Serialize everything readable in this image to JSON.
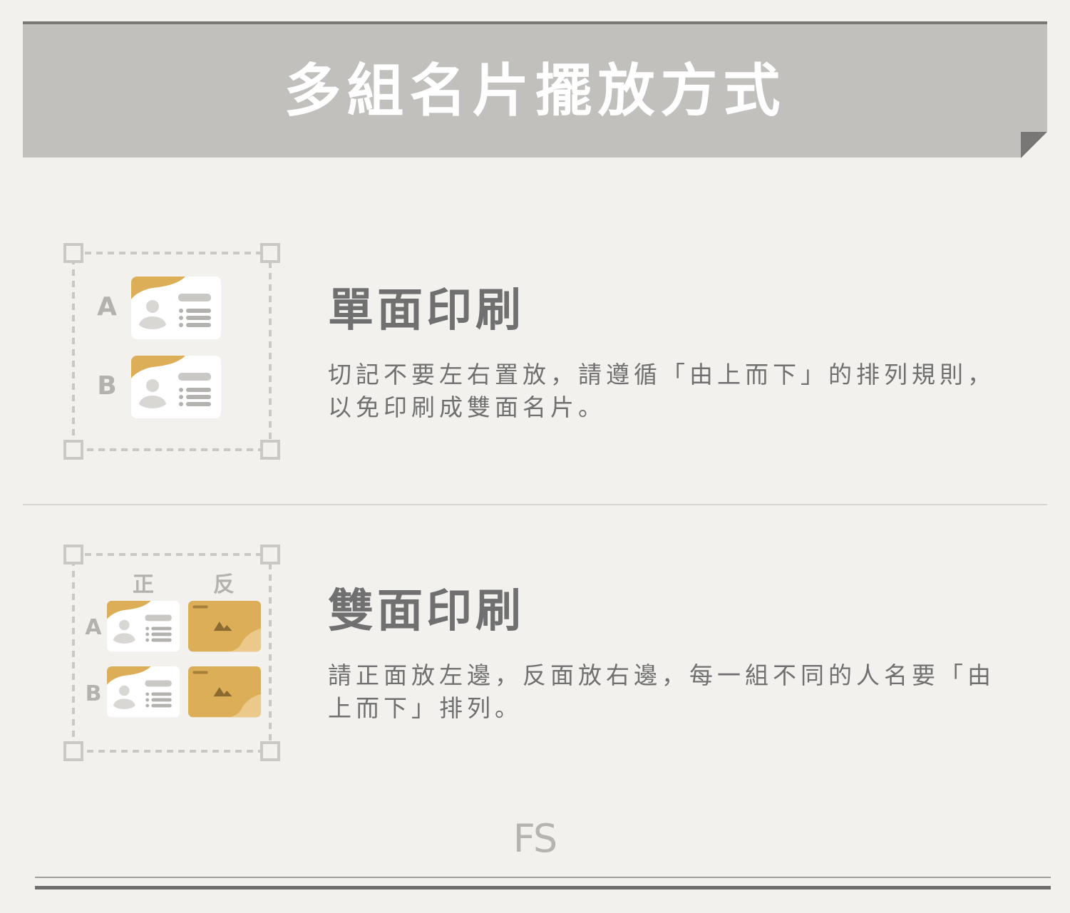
{
  "header": {
    "title": "多組名片擺放方式"
  },
  "sections": [
    {
      "heading": "單面印刷",
      "description_lines": [
        "切記不要左右置放，請遵循「由上而下」的排列規則，",
        "以免印刷成雙面名片。"
      ],
      "row_labels": [
        "A",
        "B"
      ]
    },
    {
      "heading": "雙面印刷",
      "description_lines": [
        "請正面放左邊，反面放右邊，每一組不同的人名要「由",
        "上而下」排列。"
      ],
      "column_labels": [
        "正",
        "反"
      ],
      "row_labels": [
        "A",
        "B"
      ]
    }
  ],
  "footer": {
    "logo_text": "FS"
  },
  "colors": {
    "background": "#f2f1ee",
    "banner": "#c1c0bd",
    "accent_gold": "#dcae58",
    "light_gold": "#ebc98a",
    "text_gray": "#707070",
    "icon_gray": "#c9c8c5"
  }
}
